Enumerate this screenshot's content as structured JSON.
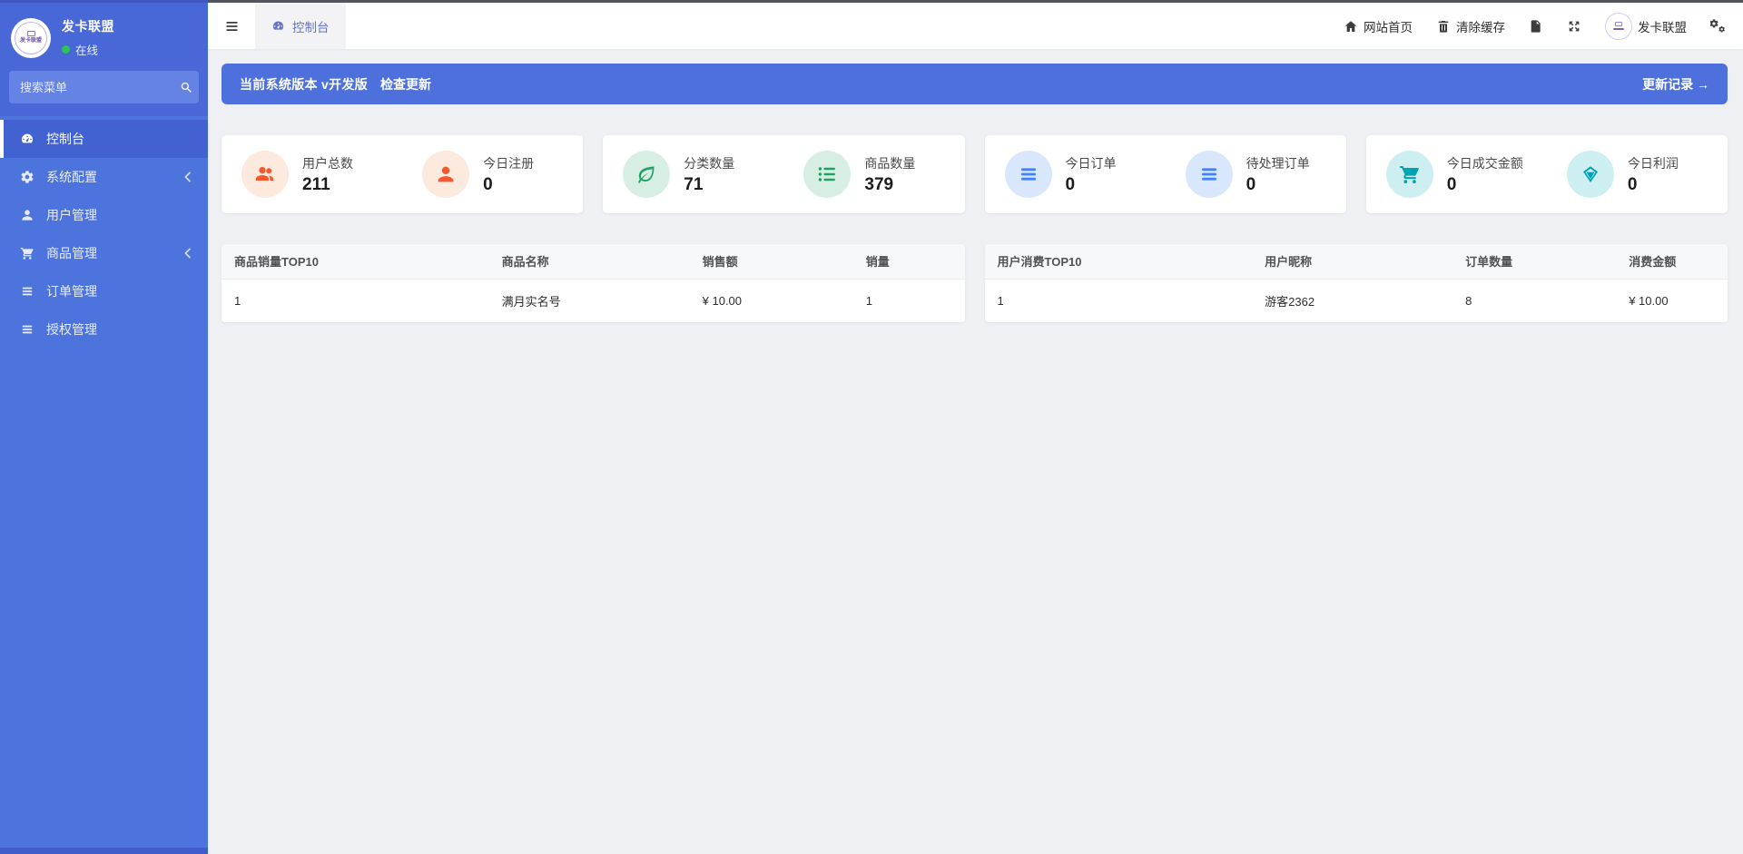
{
  "sidebar": {
    "brand": {
      "title": "发卡联盟",
      "status": "在线",
      "logo_text": "发卡联盟"
    },
    "search": {
      "placeholder": "搜索菜单"
    },
    "menu": [
      {
        "label": "控制台",
        "icon": "gauge-icon",
        "active": true
      },
      {
        "label": "系统配置",
        "icon": "gear-icon",
        "expandable": true
      },
      {
        "label": "用户管理",
        "icon": "user-icon"
      },
      {
        "label": "商品管理",
        "icon": "cart-icon",
        "expandable": true
      },
      {
        "label": "订单管理",
        "icon": "list-icon"
      },
      {
        "label": "授权管理",
        "icon": "list-icon"
      }
    ]
  },
  "topbar": {
    "tab": {
      "label": "控制台",
      "icon": "gauge-icon",
      "active": true
    },
    "actions": {
      "home_label": "网站首页",
      "clear_cache_label": "清除缓存",
      "doc_icon": "file-icon",
      "fullscreen_icon": "expand-icon",
      "username": "发卡联盟",
      "settings_icon": "cogs-icon"
    }
  },
  "banner": {
    "version_text": "当前系统版本 v开发版",
    "check_update_label": "检查更新",
    "update_log_label": "更新记录 →",
    "color": "#4d70dd"
  },
  "stats": {
    "cards": [
      {
        "accent": "#f4582c",
        "items": [
          {
            "label": "用户总数",
            "value": "211",
            "icon": "users-icon"
          },
          {
            "label": "今日注册",
            "value": "0",
            "icon": "user-icon"
          }
        ]
      },
      {
        "accent": "#21a166",
        "items": [
          {
            "label": "分类数量",
            "value": "71",
            "icon": "leaf-icon"
          },
          {
            "label": "商品数量",
            "value": "379",
            "icon": "list-icon"
          }
        ]
      },
      {
        "accent": "#3f82f6",
        "items": [
          {
            "label": "今日订单",
            "value": "0",
            "icon": "bars-icon"
          },
          {
            "label": "待处理订单",
            "value": "0",
            "icon": "bars-icon"
          }
        ]
      },
      {
        "accent": "#00a3b1",
        "items": [
          {
            "label": "今日成交金额",
            "value": "0",
            "icon": "cart-icon"
          },
          {
            "label": "今日利润",
            "value": "0",
            "icon": "diamond-icon"
          }
        ]
      }
    ]
  },
  "tables": [
    {
      "headers": [
        "商品销量TOP10",
        "商品名称",
        "销售额",
        "销量"
      ],
      "rows": [
        [
          "1",
          "满月实名号",
          "¥ 10.00",
          "1"
        ]
      ]
    },
    {
      "headers": [
        "用户消费TOP10",
        "用户昵称",
        "订单数量",
        "消费金额"
      ],
      "rows": [
        [
          "1",
          "游客2362",
          "8",
          "¥ 10.00"
        ]
      ]
    }
  ],
  "colors": {
    "sidebar": "#4d73dd",
    "sidebar_head": "#4868d8",
    "active_item": "#4362d2",
    "main_bg": "#eef0f4",
    "online_dot": "#2fc25b"
  }
}
